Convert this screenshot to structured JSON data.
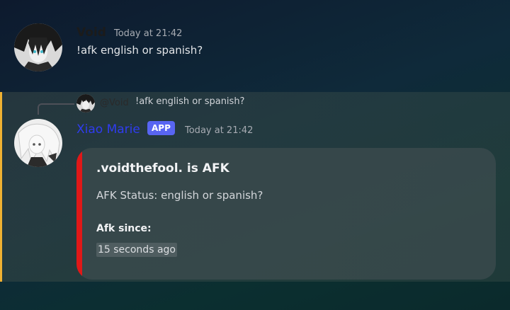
{
  "message1": {
    "username": "Void",
    "timestamp": "Today at 21:42",
    "content": "!afk english or spanish?"
  },
  "message2": {
    "reply": {
      "mention": "@Void",
      "content": "!afk english or spanish?"
    },
    "username": "Xiao Marie",
    "badge": "APP",
    "timestamp": "Today at 21:42",
    "embed": {
      "title": ".voidthefool. is AFK",
      "description": "AFK Status: english or spanish?",
      "field_name": "Afk since:",
      "field_value": "15 seconds ago",
      "accent_color": "#e01818"
    },
    "highlight_color": "#f0b132"
  },
  "colors": {
    "username_bot": "#2f3cf0",
    "badge": "#5865f2"
  }
}
